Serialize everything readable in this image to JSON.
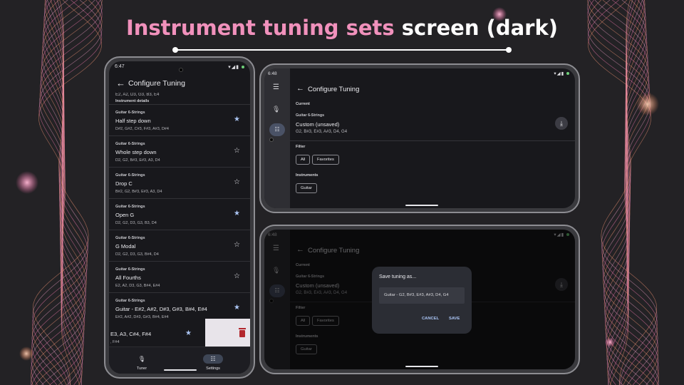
{
  "headline": {
    "accent": "Instrument tuning sets",
    "rest": " screen (dark)"
  },
  "phone_portrait": {
    "status_time": "6:47",
    "status_icons": "▾◢▮",
    "app_title": "Configure Tuning",
    "list_peek_notes": "E2, A2, D3, G3, B3, E4",
    "list_peek_header": "Instrument details",
    "tunings": [
      {
        "category": "Guitar 6-Strings",
        "name": "Half step down",
        "notes": "D#2, G#2, C#3, F#3, A#3, D#4",
        "favorite": true
      },
      {
        "category": "Guitar 6-Strings",
        "name": "Whole step down",
        "notes": "D2, G2, B#3, E#3, A3, D4",
        "favorite": false
      },
      {
        "category": "Guitar 6-Strings",
        "name": "Drop C",
        "notes": "B#2, G2, B#3, E#3, A3, D4",
        "favorite": false
      },
      {
        "category": "Guitar 6-Strings",
        "name": "Open G",
        "notes": "D2, G2, D3, G3, B3, D4",
        "favorite": true
      },
      {
        "category": "Guitar 6-Strings",
        "name": "G Modal",
        "notes": "D2, G2, D3, G3, B#4, D4",
        "favorite": false
      },
      {
        "category": "Guitar 6-Strings",
        "name": "All Fourths",
        "notes": "E2, A2, D3, G3, B#4, E#4",
        "favorite": false
      },
      {
        "category": "Guitar 6-Strings",
        "name": "Guitar - E#2, A#2, D#3, G#3, B#4, E#4",
        "notes": "E#2, A#2, D#3, G#3, B#4, E#4",
        "favorite": true
      }
    ],
    "swiped_row": {
      "name": "E3, A3, C#4, F#4",
      "notes": ", F#4",
      "favorite": true
    },
    "nav": {
      "tuner": "Tuner",
      "settings": "Settings"
    }
  },
  "phone_landscape": {
    "status_time": "6:48",
    "status_icons": "▾◢▮",
    "app_title": "Configure Tuning",
    "current_label": "Current",
    "current_category": "Guitar 6-Strings",
    "current_name": "Custom (unsaved)",
    "current_notes": "G2, B#3, E#3, A#3, D4, G4",
    "filter_label": "Filter",
    "filter_all": "All",
    "filter_favorites": "Favorites",
    "instruments_label": "Instruments",
    "instrument_guitar": "Guitar"
  },
  "dialog": {
    "title": "Save tuning as...",
    "field_value": "Guitar - G2, B#3, E#3, A#3, D4, G4",
    "cancel": "CANCEL",
    "save": "SAVE"
  },
  "colors": {
    "background": "#232225",
    "accent_pink": "#f191bc",
    "favorite_star": "#aac4f2",
    "delete_red": "#b3272d"
  },
  "icons": [
    "back-arrow-icon",
    "star-icon",
    "star-outline-icon",
    "trash-icon",
    "mic-icon",
    "tune-icon",
    "menu-icon",
    "download-icon"
  ]
}
